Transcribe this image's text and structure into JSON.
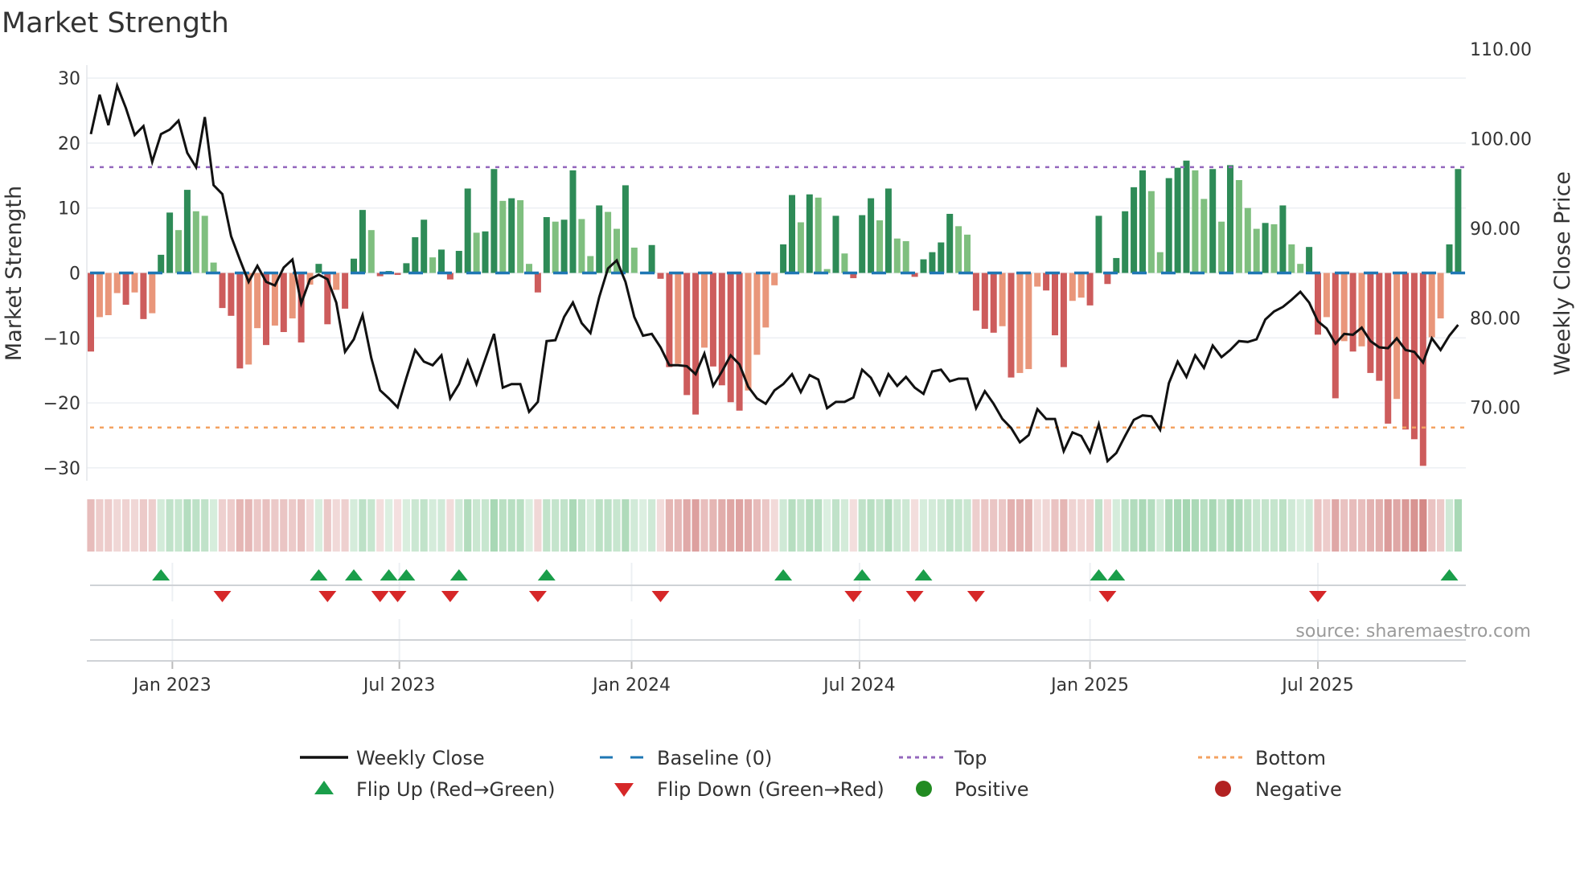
{
  "title": "Market Strength",
  "source": "source: sharemaestro.com",
  "colors": {
    "pos_strong": "#2e8b57",
    "pos_weak": "#7fbf7f",
    "neg_strong": "#cd5c5c",
    "neg_weak": "#e9967a",
    "price": "#111111",
    "baseline": "#1f77b4",
    "top": "#9467bd",
    "bottom": "#f4a261",
    "flip_up": "#1a9e4a",
    "flip_down": "#d62728",
    "positive": "#228b22",
    "negative": "#b22222"
  },
  "chart_data": {
    "type": "bar+line",
    "title": "Market Strength",
    "ylabel": "Market Strength",
    "y2label": "Weekly Close Price",
    "ylim": [
      -32,
      32
    ],
    "y2lim": [
      63.6,
      110
    ],
    "yticks": [
      "30",
      "20",
      "10",
      "0",
      "−10",
      "−20",
      "−30"
    ],
    "ytick_values": [
      30,
      20,
      10,
      0,
      -10,
      -20,
      -30
    ],
    "y2ticks": [
      "110.00",
      "100.00",
      "90.00",
      "80.00",
      "70.00"
    ],
    "y2tick_values": [
      110,
      100,
      90,
      80,
      70
    ],
    "x_ticks": [
      {
        "label": "Jan 2023",
        "index": 9.3
      },
      {
        "label": "Jul 2023",
        "index": 35.2
      },
      {
        "label": "Jan 2024",
        "index": 61.7
      },
      {
        "label": "Jul 2024",
        "index": 87.7
      },
      {
        "label": "Jan 2025",
        "index": 114.0
      },
      {
        "label": "Jul 2025",
        "index": 140.0
      }
    ],
    "top_level": 16.3,
    "bottom_level": -23.8,
    "baseline": 0,
    "strength": [
      -12.1,
      -6.8,
      -6.5,
      -3.1,
      -4.9,
      -3.0,
      -7.1,
      -6.2,
      2.8,
      9.3,
      6.6,
      12.8,
      9.5,
      8.8,
      1.6,
      -5.4,
      -6.6,
      -14.7,
      -14.1,
      -8.5,
      -11.1,
      -8.1,
      -9.1,
      -7.0,
      -10.7,
      -1.8,
      1.4,
      -7.9,
      -2.6,
      -5.5,
      2.2,
      9.7,
      6.6,
      -0.5,
      0.3,
      -0.3,
      1.5,
      5.5,
      8.2,
      2.4,
      3.6,
      -1.0,
      3.4,
      13.0,
      6.2,
      6.4,
      16.0,
      11.1,
      11.5,
      11.2,
      1.4,
      -3.0,
      8.6,
      7.9,
      8.2,
      15.8,
      8.3,
      2.6,
      10.4,
      9.4,
      6.8,
      13.5,
      3.9,
      0.0,
      4.3,
      -0.9,
      -14.5,
      -14.0,
      -18.8,
      -21.8,
      -11.5,
      -14.4,
      -17.3,
      -19.9,
      -21.2,
      -18.1,
      -12.6,
      -8.4,
      -1.9,
      4.4,
      12.0,
      7.8,
      12.1,
      11.6,
      0.6,
      8.8,
      3.0,
      -0.8,
      8.9,
      11.5,
      8.1,
      13.0,
      5.3,
      4.9,
      -0.6,
      2.1,
      3.2,
      4.7,
      9.1,
      7.2,
      5.9,
      -5.8,
      -8.6,
      -9.2,
      -8.2,
      -16.1,
      -15.4,
      -14.8,
      -2.1,
      -2.7,
      -9.6,
      -14.5,
      -4.3,
      -3.8,
      -5.0,
      8.8,
      -1.7,
      2.3,
      9.5,
      13.2,
      15.8,
      12.6,
      3.2,
      14.6,
      16.2,
      17.3,
      15.8,
      11.4,
      16.0,
      7.9,
      16.6,
      14.3,
      10.0,
      6.8,
      7.7,
      7.5,
      10.4,
      4.4,
      1.4,
      4.0,
      -9.5,
      -6.8,
      -19.3,
      -10.5,
      -12.1,
      -11.3,
      -15.4,
      -16.6,
      -23.2,
      -19.4,
      -24.1,
      -25.6,
      -29.7,
      -9.9,
      -7.0,
      4.4,
      16.0
    ],
    "strong": [
      1,
      0,
      0,
      0,
      1,
      0,
      1,
      0,
      1,
      1,
      0,
      1,
      0,
      0,
      0,
      1,
      1,
      1,
      0,
      0,
      1,
      0,
      1,
      0,
      1,
      0,
      1,
      1,
      0,
      1,
      1,
      1,
      0,
      1,
      1,
      1,
      1,
      1,
      1,
      0,
      1,
      1,
      1,
      1,
      0,
      1,
      1,
      0,
      1,
      0,
      0,
      1,
      1,
      0,
      1,
      1,
      0,
      0,
      1,
      0,
      0,
      1,
      0,
      0,
      1,
      1,
      1,
      0,
      1,
      1,
      0,
      1,
      1,
      1,
      1,
      0,
      0,
      0,
      0,
      1,
      1,
      0,
      1,
      0,
      0,
      1,
      0,
      1,
      1,
      1,
      0,
      1,
      0,
      0,
      1,
      1,
      1,
      1,
      1,
      0,
      0,
      1,
      1,
      1,
      0,
      1,
      0,
      0,
      0,
      1,
      1,
      1,
      0,
      0,
      1,
      1,
      1,
      1,
      1,
      1,
      1,
      0,
      0,
      1,
      1,
      1,
      0,
      0,
      1,
      0,
      1,
      0,
      0,
      0,
      1,
      0,
      1,
      0,
      0,
      1,
      1,
      0,
      1,
      0,
      1,
      0,
      1,
      1,
      1,
      0,
      1,
      1,
      1,
      0,
      0,
      1,
      1
    ],
    "weekly_close": [
      102.3,
      106.7,
      103.3,
      107.7,
      105.2,
      102.2,
      103.2,
      99.2,
      102.3,
      102.8,
      103.8,
      100.2,
      98.6,
      104.2,
      96.6,
      95.6,
      90.9,
      88.3,
      85.8,
      87.6,
      85.8,
      85.4,
      87.4,
      88.3,
      83.4,
      86.1,
      86.6,
      86.1,
      83.5,
      78.0,
      79.4,
      82.1,
      77.3,
      73.7,
      72.8,
      71.8,
      75.1,
      78.2,
      76.9,
      76.5,
      77.6,
      72.8,
      74.4,
      77.0,
      74.4,
      77.2,
      80.0,
      74.0,
      74.4,
      74.4,
      71.3,
      72.4,
      79.2,
      79.3,
      81.9,
      83.5,
      81.2,
      80.1,
      84.1,
      87.3,
      88.2,
      85.8,
      81.9,
      79.8,
      80.0,
      78.5,
      76.5,
      76.5,
      76.4,
      75.5,
      77.8,
      74.2,
      75.8,
      77.6,
      76.6,
      74.1,
      72.8,
      72.2,
      73.7,
      74.4,
      75.5,
      73.5,
      75.4,
      74.9,
      71.7,
      72.4,
      72.4,
      72.9,
      76.0,
      75.1,
      73.2,
      75.5,
      74.2,
      75.2,
      74.0,
      73.3,
      75.8,
      76.0,
      74.7,
      75.0,
      75.0,
      71.7,
      73.6,
      72.2,
      70.5,
      69.5,
      67.9,
      68.7,
      71.6,
      70.5,
      70.5,
      66.9,
      69.0,
      68.6,
      66.8,
      69.9,
      65.8,
      66.7,
      68.6,
      70.4,
      70.9,
      70.8,
      69.3,
      74.5,
      76.9,
      75.2,
      77.6,
      76.2,
      78.7,
      77.4,
      78.2,
      79.2,
      79.1,
      79.4,
      81.6,
      82.5,
      83.0,
      83.8,
      84.7,
      83.5,
      81.4,
      80.6,
      78.9,
      80.0,
      79.9,
      80.7,
      79.2,
      78.5,
      78.4,
      79.5,
      78.2,
      78.0,
      76.8,
      79.5,
      78.2,
      79.8,
      81.0
    ],
    "flip_up": [
      8,
      26,
      30,
      34,
      36,
      42,
      52,
      79,
      88,
      95,
      115,
      117,
      155
    ],
    "flip_down": [
      15,
      27,
      33,
      35,
      41,
      51,
      65,
      87,
      94,
      101,
      116,
      140
    ],
    "legend": {
      "placement": "bottom",
      "items": [
        {
          "label": "Weekly Close",
          "symbol": "line"
        },
        {
          "label": "Baseline (0)",
          "symbol": "dash"
        },
        {
          "label": "Top",
          "symbol": "dot-purple"
        },
        {
          "label": "Bottom",
          "symbol": "dot-orange"
        },
        {
          "label": "Flip Up (Red→Green)",
          "symbol": "triangle-up"
        },
        {
          "label": "Flip Down (Green→Red)",
          "symbol": "triangle-down"
        },
        {
          "label": "Positive",
          "symbol": "circle-green"
        },
        {
          "label": "Negative",
          "symbol": "circle-red"
        }
      ]
    }
  }
}
